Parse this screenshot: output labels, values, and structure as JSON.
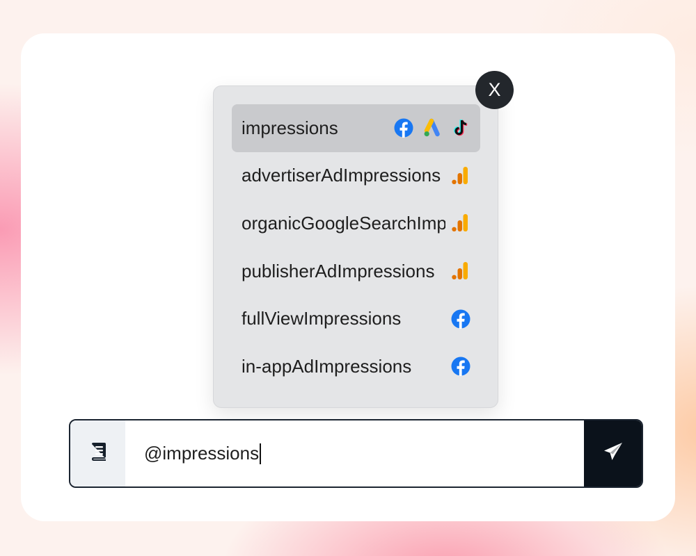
{
  "close_button": {
    "label": "X"
  },
  "suggestions": [
    {
      "label": "impressions",
      "selected": true,
      "icons": [
        "facebook-icon",
        "google-ads-icon",
        "tiktok-icon"
      ]
    },
    {
      "label": "advertiserAdImpressions",
      "selected": false,
      "icons": [
        "google-analytics-icon"
      ]
    },
    {
      "label": "organicGoogleSearchImpressions",
      "selected": false,
      "icons": [
        "google-analytics-icon"
      ]
    },
    {
      "label": "publisherAdImpressions",
      "selected": false,
      "icons": [
        "google-analytics-icon"
      ]
    },
    {
      "label": "fullViewImpressions",
      "selected": false,
      "icons": [
        "facebook-icon"
      ]
    },
    {
      "label": "in-appAdImpressions",
      "selected": false,
      "icons": [
        "facebook-icon"
      ]
    }
  ],
  "input": {
    "value": "@impressions"
  },
  "icons": {
    "docs_button": "book-icon",
    "send_button": "paper-plane-icon"
  },
  "colors": {
    "facebook": "#1877f2",
    "google_ads_blue": "#4285f4",
    "google_ads_yellow": "#fbbc04",
    "google_ads_green": "#34a853",
    "analytics_orange": "#f9ab00",
    "analytics_dark_orange": "#e37400",
    "send_button_bg": "#0b121b"
  }
}
